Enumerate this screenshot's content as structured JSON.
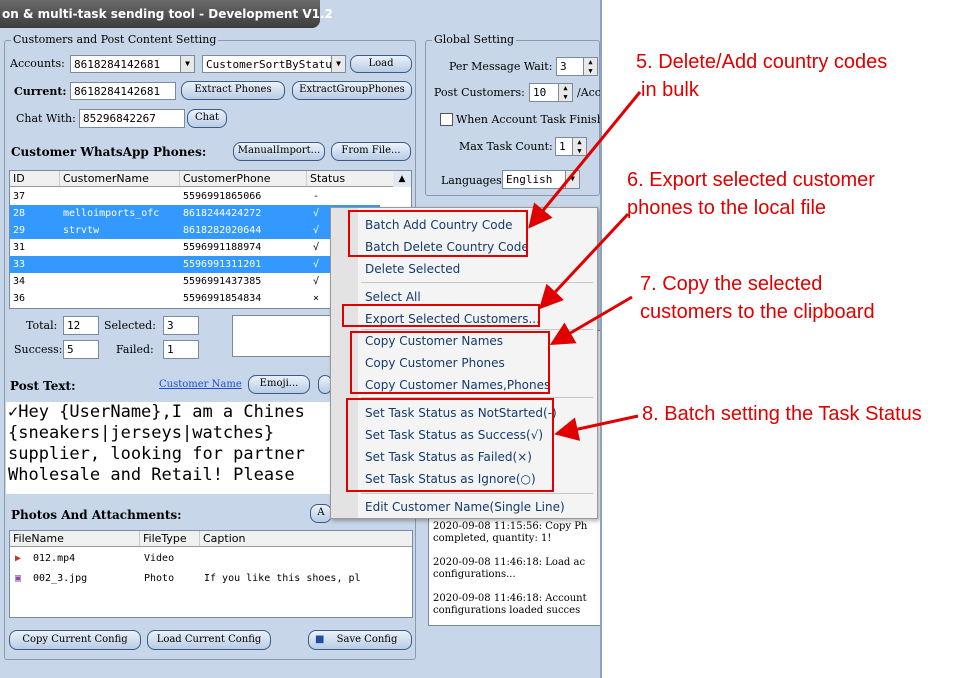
{
  "window": {
    "title": "on & multi-task sending tool - Development V1.2"
  },
  "customers_section": {
    "legend": "Customers and Post Content Setting",
    "accounts_label": "Accounts:",
    "accounts_value": "8618284142681",
    "sort_value": "CustomerSortByStatu",
    "load_button": "Load",
    "current_label": "Current:",
    "current_value": "8618284142681",
    "extract_phones_button": "Extract Phones",
    "extract_group_button": "ExtractGroupPhones",
    "chat_with_label": "Chat With:",
    "chat_with_value": "85296842267",
    "chat_button": "Chat",
    "phones_heading": "Customer WhatsApp Phones:",
    "manual_import_button": "ManualImport...",
    "from_file_button": "From File..."
  },
  "table": {
    "headers": [
      "ID",
      "CustomerName",
      "CustomerPhone",
      "Status"
    ],
    "rows": [
      {
        "id": "37",
        "name": "",
        "phone": "5596991865066",
        "status": "-"
      },
      {
        "id": "28",
        "name": "melloimports_ofc",
        "phone": "8618244424272",
        "status": "√"
      },
      {
        "id": "29",
        "name": "strvtw",
        "phone": "8618282020644",
        "status": "√"
      },
      {
        "id": "31",
        "name": "",
        "phone": "5596991188974",
        "status": "√"
      },
      {
        "id": "33",
        "name": "",
        "phone": "5596991311201",
        "status": "√"
      },
      {
        "id": "34",
        "name": "",
        "phone": "5596991437385",
        "status": "√"
      },
      {
        "id": "36",
        "name": "",
        "phone": "5596991854834",
        "status": "×"
      }
    ]
  },
  "stats": {
    "total_label": "Total:",
    "total_value": "12",
    "selected_label": "Selected:",
    "selected_value": "3",
    "success_label": "Success:",
    "success_value": "5",
    "failed_label": "Failed:",
    "failed_value": "1"
  },
  "post": {
    "label": "Post Text:",
    "customer_name_link": "Customer Name",
    "emoji_button": "Emoji...",
    "text_lines": [
      "✓Hey {UserName},I am a Chines",
      "{sneakers|jerseys|watches}",
      "supplier, looking for partner",
      "Wholesale and Retail! Please"
    ]
  },
  "attachments": {
    "label": "Photos And Attachments:",
    "headers": [
      "FileName",
      "FileType",
      "Caption"
    ],
    "rows": [
      {
        "name": "012.mp4",
        "type": "Video",
        "caption": ""
      },
      {
        "name": "002_3.jpg",
        "type": "Photo",
        "caption": "If you like this shoes, pl"
      }
    ]
  },
  "bottom_buttons": {
    "copy_config": "Copy Current Config",
    "load_config": "Load Current Config",
    "save_config": "Save Config"
  },
  "global": {
    "legend": "Global Setting",
    "wait_label": "Per Message Wait:",
    "wait_value": "3",
    "post_customers_label": "Post Customers:",
    "post_customers_value": "10",
    "post_customers_suffix": "/Acc",
    "finish_label": "When Account Task Finish",
    "max_task_label": "Max Task Count:",
    "max_task_value": "1",
    "languages_label": "Languages:",
    "languages_value": "English"
  },
  "log": [
    "2020-09-08 11:15:56: Copy Ph completed, quantity: 1!",
    "2020-09-08 11:46:18: Load ac configurations...",
    "2020-09-08 11:46:18: Account configurations loaded succes"
  ],
  "context_menu": {
    "items": [
      "Batch Add Country Code",
      "Batch Delete Country Code",
      "Delete Selected",
      "Select All",
      "Export Selected Customers...",
      "Copy Customer Names",
      "Copy Customer Phones",
      "Copy Customer Names,Phones",
      "Set Task Status as NotStarted(-)",
      "Set Task Status as Success(√)",
      "Set Task Status as Failed(×)",
      "Set Task Status as Ignore(○)",
      "Edit Customer Name(Single Line)"
    ]
  },
  "annotations": [
    "5. Delete/Add country codes",
    "in bulk",
    "6. Export selected customer",
    "phones to the local file",
    "7. Copy the selected",
    "customers to the clipboard",
    "8. Batch setting the Task Status"
  ],
  "colors": {
    "annotation": "#e00000",
    "selection": "#3399ff",
    "menu_text": "#123b6d"
  }
}
